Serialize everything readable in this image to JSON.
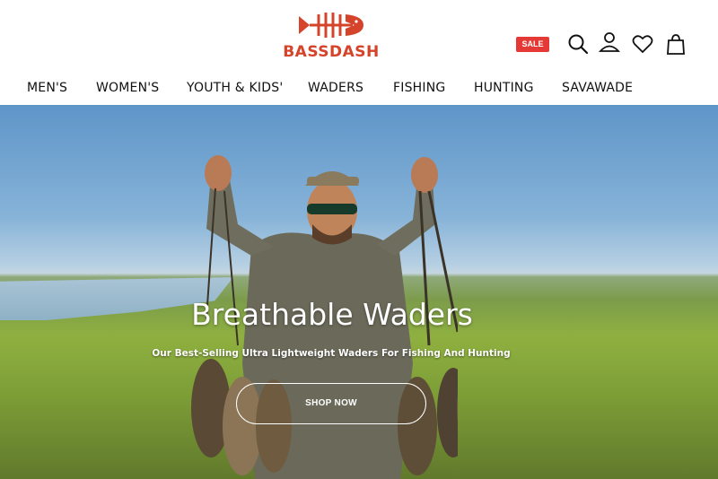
{
  "brand": {
    "logo_text": "BASSDASH",
    "brand_color": "#d4432a"
  },
  "header": {
    "sale_badge": "SALE",
    "sale_color": "#e53935",
    "icons": [
      "search-icon",
      "account-icon",
      "wishlist-icon",
      "cart-icon"
    ]
  },
  "nav": {
    "items": [
      "MEN'S",
      "WOMEN'S",
      "YOUTH & KIDS'",
      "WADERS",
      "FISHING",
      "HUNTING",
      "SAVAWADE"
    ]
  },
  "hero": {
    "title": "Breathable Waders",
    "subtitle": "Our Best-Selling Ultra Lightweight Waders For Fishing And Hunting",
    "cta": "SHOP NOW"
  }
}
